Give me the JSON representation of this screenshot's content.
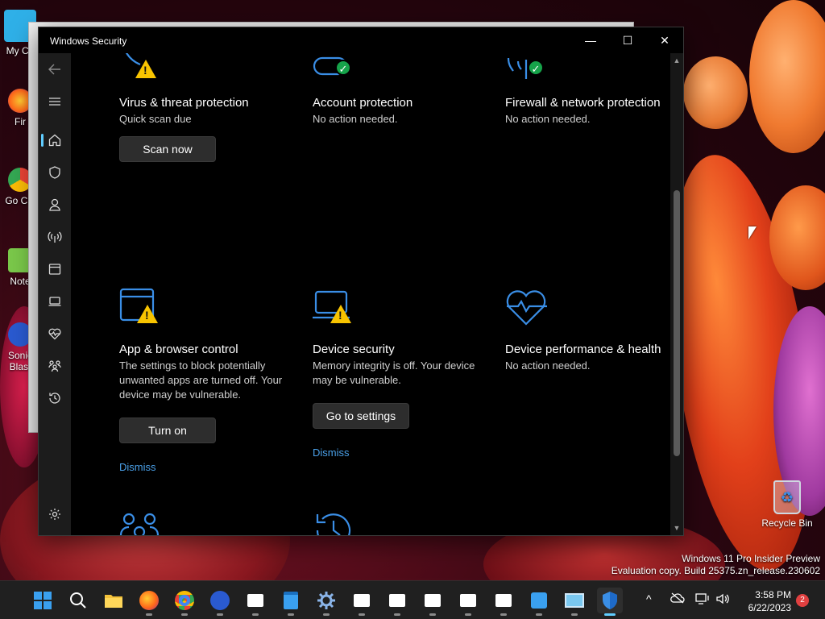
{
  "window": {
    "title": "Windows Security",
    "minimize_glyph": "—",
    "maximize_glyph": "☐",
    "close_glyph": "✕"
  },
  "nav": {
    "items": [
      {
        "name": "back",
        "icon": "back-arrow-icon"
      },
      {
        "name": "menu",
        "icon": "hamburger-icon"
      },
      {
        "name": "home",
        "icon": "home-icon",
        "active": true
      },
      {
        "name": "virus-threat",
        "icon": "shield-icon"
      },
      {
        "name": "account",
        "icon": "person-icon"
      },
      {
        "name": "firewall",
        "icon": "antenna-icon"
      },
      {
        "name": "app-browser",
        "icon": "browser-window-icon"
      },
      {
        "name": "device-security",
        "icon": "laptop-icon"
      },
      {
        "name": "device-health",
        "icon": "heart-pulse-icon"
      },
      {
        "name": "family",
        "icon": "family-icon"
      },
      {
        "name": "history",
        "icon": "history-icon"
      },
      {
        "name": "settings",
        "icon": "gear-icon"
      }
    ]
  },
  "tiles": [
    {
      "id": "virus",
      "title": "Virus & threat protection",
      "status": "Quick scan due",
      "button": "Scan now",
      "badge": "warning"
    },
    {
      "id": "account",
      "title": "Account protection",
      "status": "No action needed.",
      "badge": "ok"
    },
    {
      "id": "firewall",
      "title": "Firewall & network protection",
      "status": "No action needed.",
      "badge": "ok"
    },
    {
      "id": "appbrowser",
      "title": "App & browser control",
      "status": "The settings to block potentially unwanted apps are turned off. Your device may be vulnerable.",
      "button": "Turn on",
      "link": "Dismiss",
      "badge": "warning"
    },
    {
      "id": "devicesec",
      "title": "Device security",
      "status": "Memory integrity is off. Your device may be vulnerable.",
      "button": "Go to settings",
      "link": "Dismiss",
      "badge": "warning"
    },
    {
      "id": "devicehealth",
      "title": "Device performance & health",
      "status": "No action needed."
    }
  ],
  "desktop": {
    "icons": [
      {
        "label": "My Co",
        "icon": "computer-icon"
      },
      {
        "label": "Fir",
        "icon": "firefox-icon"
      },
      {
        "label": "Go Chi",
        "icon": "chrome-icon"
      },
      {
        "label": "Note",
        "icon": "notepad-icon"
      },
      {
        "label": "Sonic Blast",
        "icon": "sonic-icon"
      }
    ],
    "recycle_bin": "Recycle Bin",
    "watermark_line1": "Windows 11 Pro Insider Preview",
    "watermark_line2": "Evaluation copy. Build 25375.zn_release.230602"
  },
  "taskbar": {
    "apps": [
      {
        "name": "start",
        "icon": "windows-logo-icon"
      },
      {
        "name": "search",
        "icon": "search-icon"
      },
      {
        "name": "file-explorer",
        "icon": "folder-icon"
      },
      {
        "name": "firefox",
        "icon": "firefox-icon"
      },
      {
        "name": "chrome",
        "icon": "chrome-icon"
      },
      {
        "name": "sonic",
        "icon": "sonic-icon"
      },
      {
        "name": "app-1",
        "icon": "pixel-critter-icon"
      },
      {
        "name": "notepad",
        "icon": "notepad-icon"
      },
      {
        "name": "settings",
        "icon": "gear-icon"
      },
      {
        "name": "app-2",
        "icon": "pixel-critter-icon"
      },
      {
        "name": "app-3",
        "icon": "pixel-critter-icon"
      },
      {
        "name": "app-4",
        "icon": "pixel-critter-icon"
      },
      {
        "name": "app-5",
        "icon": "pixel-critter-icon"
      },
      {
        "name": "app-6",
        "icon": "pixel-critter-icon"
      },
      {
        "name": "app-7",
        "icon": "puzzle-icon"
      },
      {
        "name": "app-8",
        "icon": "monitor-icon"
      },
      {
        "name": "windows-security",
        "icon": "shield-icon",
        "active": true
      }
    ],
    "clock_time": "3:58 PM",
    "clock_date": "6/22/2023",
    "notification_count": "2",
    "tray_chevron": "^"
  },
  "colors": {
    "accent": "#60cdff",
    "link": "#4aa0e8",
    "icon_blue": "#3a8ee6",
    "warning": "#f8c400",
    "ok": "#16a34a"
  }
}
